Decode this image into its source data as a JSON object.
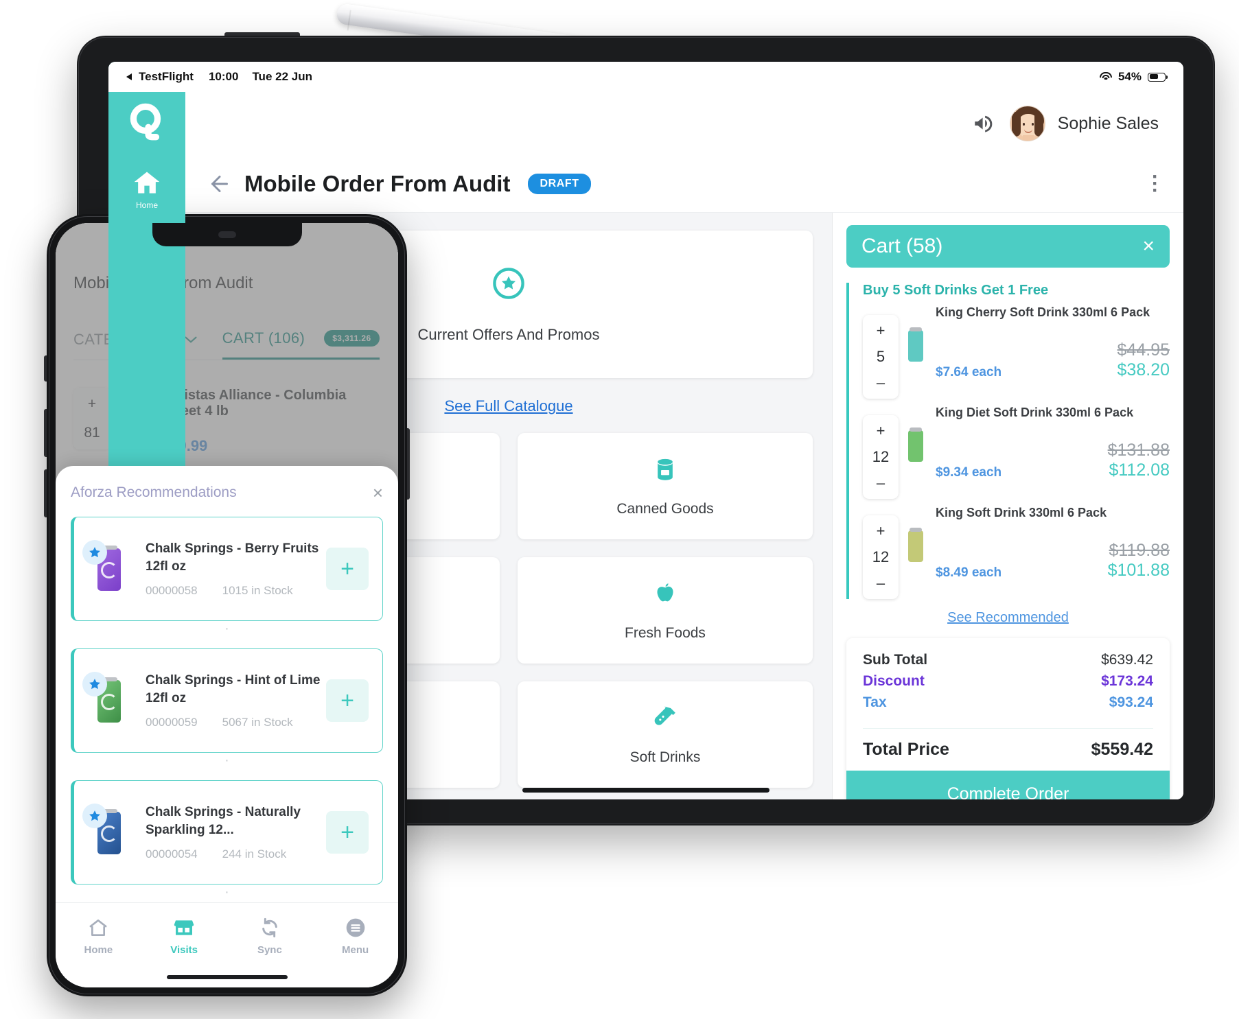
{
  "tablet": {
    "status_bar": {
      "back_app": "TestFlight",
      "time": "10:00",
      "date": "Tue 22 Jun",
      "battery": "54%"
    },
    "rail": {
      "home_label": "Home"
    },
    "top_bar": {
      "user_name": "Sophie Sales"
    },
    "header": {
      "title": "Mobile Order From Audit",
      "status_badge": "DRAFT"
    },
    "promo": {
      "label": "Current Offers And Promos",
      "catalogue_link": "See Full Catalogue"
    },
    "categories": [
      {
        "label": "Canned Goods",
        "icon": "can-icon"
      },
      {
        "label": "Fresh Foods",
        "icon": "apple-icon"
      },
      {
        "label": "Soft Drinks",
        "icon": "bottle-icon"
      }
    ],
    "cart": {
      "title": "Cart (58)",
      "promo_group_title": "Buy 5 Soft Drinks Get 1 Free",
      "items": [
        {
          "name": "King Cherry Soft Drink 330ml 6 Pack",
          "qty": "5",
          "each": "$7.64 each",
          "was": "$44.95",
          "now": "$38.20",
          "can_color": "#5fc9c2"
        },
        {
          "name": "King Diet Soft Drink 330ml 6 Pack",
          "qty": "12",
          "each": "$9.34 each",
          "was": "$131.88",
          "now": "$112.08",
          "can_color": "#72c36e"
        },
        {
          "name": "King Soft Drink 330ml 6 Pack",
          "qty": "12",
          "each": "$8.49 each",
          "was": "$119.88",
          "now": "$101.88",
          "can_color": "#c3c977"
        }
      ],
      "see_recommended": "See Recommended",
      "totals": {
        "sub_total_label": "Sub Total",
        "sub_total_value": "$639.42",
        "discount_label": "Discount",
        "discount_value": "$173.24",
        "tax_label": "Tax",
        "tax_value": "$93.24",
        "total_label": "Total Price",
        "total_value": "$559.42"
      },
      "complete_button": "Complete Order",
      "plus": "+",
      "minus": "–",
      "close": "×"
    }
  },
  "phone": {
    "title": "Mobile Order From Audit",
    "tabs": {
      "categories_label": "CATEGORIES",
      "cart_label": "CART (106)",
      "cart_amount": "$3,311.26"
    },
    "list_item": {
      "name": "Baristas Alliance - Columbia Sweet 4 lb",
      "qty": "81",
      "price": "$29.99",
      "plus": "+"
    },
    "modal": {
      "title": "Aforza Recommendations",
      "close": "×",
      "add": "+",
      "recommendations": [
        {
          "name": "Chalk Springs - Berry Fruits 12fl oz",
          "code": "00000058",
          "stock": "1015 in Stock",
          "can_color": "#8d4fd6"
        },
        {
          "name": "Chalk Springs - Hint of Lime 12fl oz",
          "code": "00000059",
          "stock": "5067 in Stock",
          "can_color": "#56a85a"
        },
        {
          "name": "Chalk Springs - Naturally Sparkling 12...",
          "code": "00000054",
          "stock": "244 in Stock",
          "can_color": "#2f62ab"
        }
      ]
    },
    "nav": [
      {
        "label": "Home",
        "icon": "home-icon",
        "active": false
      },
      {
        "label": "Visits",
        "icon": "store-icon",
        "active": true
      },
      {
        "label": "Sync",
        "icon": "sync-icon",
        "active": false
      },
      {
        "label": "Menu",
        "icon": "menu-icon",
        "active": false
      }
    ]
  },
  "colors": {
    "brand": "#4ccdc4",
    "accent_blue": "#4e95e0",
    "discount_purple": "#6b35d8",
    "badge_blue": "#1d8fe0"
  }
}
